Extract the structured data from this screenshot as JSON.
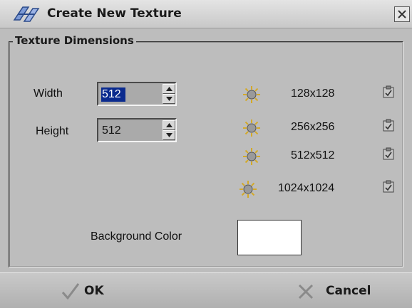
{
  "window": {
    "title": "Create New Texture",
    "close_icon": "close-icon"
  },
  "group": {
    "title": "Texture Dimensions"
  },
  "width": {
    "label": "Width",
    "value": "512"
  },
  "height": {
    "label": "Height",
    "value": "512"
  },
  "presets": [
    {
      "label": "128x128"
    },
    {
      "label": "256x256"
    },
    {
      "label": "512x512"
    },
    {
      "label": "1024x1024"
    }
  ],
  "background": {
    "label": "Background Color",
    "color": "#ffffff"
  },
  "buttons": {
    "ok": "OK",
    "cancel": "Cancel"
  }
}
